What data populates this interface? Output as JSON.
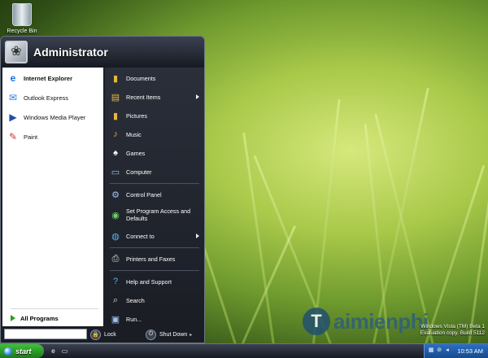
{
  "desktop": {
    "recycle_bin_label": "Recycle Bin",
    "watermark_line1": "Windows Vista (TM) Beta 1",
    "watermark_line2": "Evaluation copy. Build 5112",
    "brand_logo_letter": "T",
    "brand_text": "aimienphi"
  },
  "start_menu": {
    "user_name": "Administrator",
    "pinned": [
      {
        "label": "Internet Explorer",
        "icon": "internet-explorer-icon",
        "bold": true
      },
      {
        "label": "Outlook Express",
        "icon": "outlook-express-icon",
        "bold": false
      },
      {
        "label": "Windows Media Player",
        "icon": "media-player-icon",
        "bold": false
      },
      {
        "label": "Paint",
        "icon": "paint-icon",
        "bold": false
      }
    ],
    "all_programs_label": "All Programs",
    "right_items": [
      {
        "label": "Documents",
        "icon": "documents-folder-icon"
      },
      {
        "label": "Recent Items",
        "icon": "recent-items-icon",
        "submenu": true
      },
      {
        "label": "Pictures",
        "icon": "pictures-folder-icon"
      },
      {
        "label": "Music",
        "icon": "music-folder-icon"
      },
      {
        "label": "Games",
        "icon": "games-icon"
      },
      {
        "label": "Computer",
        "icon": "computer-icon"
      },
      {
        "label": "Control Panel",
        "icon": "control-panel-icon"
      },
      {
        "label": "Set Program Access and Defaults",
        "icon": "program-defaults-icon"
      },
      {
        "label": "Connect to",
        "icon": "connect-to-icon",
        "submenu": true
      },
      {
        "label": "Printers and Faxes",
        "icon": "printer-icon"
      },
      {
        "label": "Help and Support",
        "icon": "help-icon"
      },
      {
        "label": "Search",
        "icon": "search-icon"
      },
      {
        "label": "Run...",
        "icon": "run-icon"
      }
    ],
    "search_placeholder": "",
    "lock_label": "Lock",
    "shutdown_label": "Shut Down"
  },
  "taskbar": {
    "start_label": "start",
    "clock": "10:53 AM"
  },
  "colors": {
    "start_button": "#2a9a26",
    "menu_dark": "#1c1f26",
    "tray_blue": "#1f5cab"
  }
}
